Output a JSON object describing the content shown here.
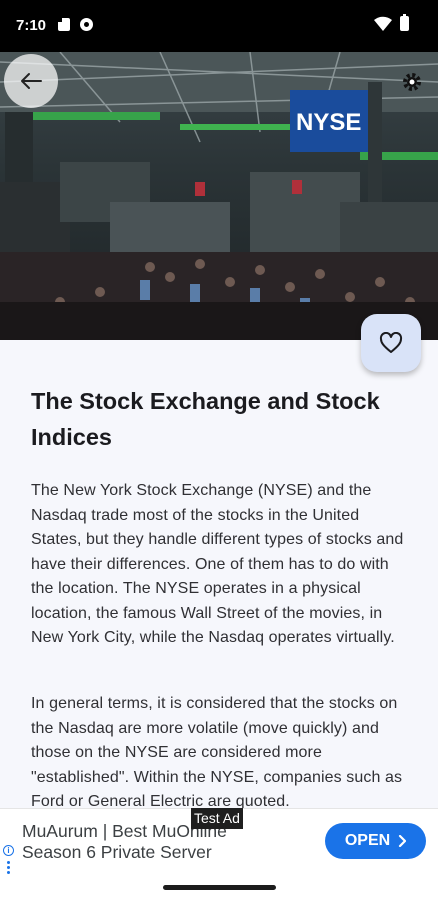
{
  "status_bar": {
    "time": "7:10",
    "icons": [
      "sd-card-icon",
      "camera-icon",
      "wifi-icon",
      "battery-icon"
    ]
  },
  "hero": {
    "image_description_icon": "stock-exchange-floor-image",
    "sign_text": "NYSE"
  },
  "toolbar": {
    "back_icon": "arrow-left-icon",
    "share_icon": "gear-icon",
    "favorite_icon": "heart-outline-icon"
  },
  "article": {
    "title": "The Stock Exchange and Stock Indices",
    "paragraphs": [
      "The New York Stock Exchange (NYSE) and the Nasdaq trade most of the stocks in the United States, but they handle different types of stocks and have their differences. One of them has to do with the location. The NYSE operates in a physical location, the famous Wall Street of the movies, in New York City, while the Nasdaq operates virtually.",
      "In general terms, it is considered that the stocks on the Nasdaq are more volatile (move quickly) and those on the NYSE are considered more \"established\". Within the NYSE, companies such as Ford or General Electric are quoted."
    ]
  },
  "ad": {
    "tag": "Test Ad",
    "line1": "MuAurum | Best MuOnline",
    "line2": "Season 6 Private Server",
    "cta": "OPEN",
    "accent": "#1a73e8"
  },
  "colors": {
    "background": "#f6f7fc",
    "fab": "#d9e3f8",
    "status_bar": "#000000"
  }
}
